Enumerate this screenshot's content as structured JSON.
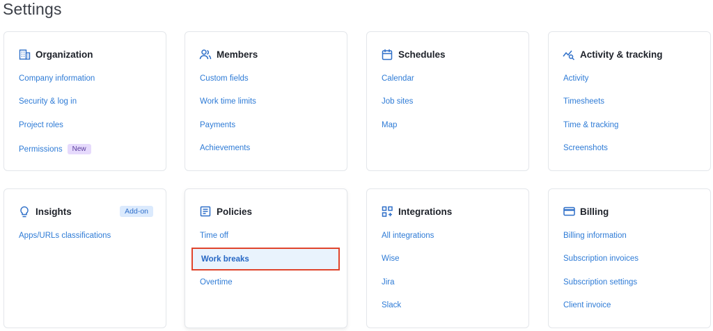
{
  "page_title": "Settings",
  "cards": {
    "organization": {
      "title": "Organization",
      "icon": "building-icon",
      "links": [
        "Company information",
        "Security & log in",
        "Project roles",
        "Permissions"
      ],
      "permissions_badge": "New"
    },
    "members": {
      "title": "Members",
      "icon": "users-icon",
      "links": [
        "Custom fields",
        "Work time limits",
        "Payments",
        "Achievements"
      ]
    },
    "schedules": {
      "title": "Schedules",
      "icon": "calendar-icon",
      "links": [
        "Calendar",
        "Job sites",
        "Map"
      ]
    },
    "activity": {
      "title": "Activity & tracking",
      "icon": "activity-chart-icon",
      "links": [
        "Activity",
        "Timesheets",
        "Time & tracking",
        "Screenshots"
      ]
    },
    "insights": {
      "title": "Insights",
      "icon": "lightbulb-icon",
      "badge": "Add-on",
      "links": [
        "Apps/URLs classifications"
      ]
    },
    "policies": {
      "title": "Policies",
      "icon": "document-icon",
      "links": [
        "Time off",
        "Work breaks",
        "Overtime"
      ],
      "selected": "Work breaks"
    },
    "integrations": {
      "title": "Integrations",
      "icon": "grid-plus-icon",
      "links": [
        "All integrations",
        "Wise",
        "Jira",
        "Slack"
      ]
    },
    "billing": {
      "title": "Billing",
      "icon": "credit-card-icon",
      "links": [
        "Billing information",
        "Subscription invoices",
        "Subscription settings",
        "Client invoice"
      ]
    }
  },
  "colors": {
    "accent": "#2e7bd6",
    "highlight_border": "#e0442c",
    "new_badge_bg": "#e6dafc",
    "addon_badge_bg": "#dbeafd"
  }
}
